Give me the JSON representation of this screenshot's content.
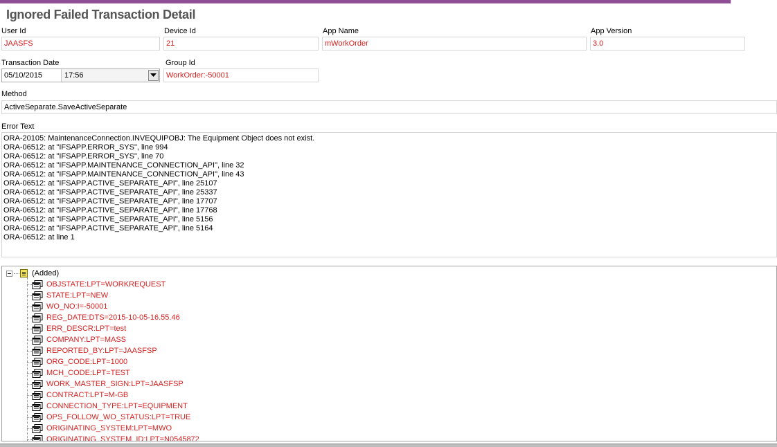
{
  "page": {
    "title": "Ignored Failed Transaction Detail"
  },
  "colors": {
    "accent": "#8e4f94",
    "value_text": "#d42020"
  },
  "fields": {
    "user_id": {
      "label": "User Id",
      "value": "JAASFS"
    },
    "device_id": {
      "label": "Device Id",
      "value": "21"
    },
    "app_name": {
      "label": "App Name",
      "value": "mWorkOrder"
    },
    "app_version": {
      "label": "App Version",
      "value": "3.0"
    },
    "transaction_date": {
      "label": "Transaction Date",
      "date": "05/10/2015",
      "time": "17:56"
    },
    "group_id": {
      "label": "Group Id",
      "value": "WorkOrder:-50001"
    },
    "method": {
      "label": "Method",
      "value": "ActiveSeparate.SaveActiveSeparate"
    },
    "error_text": {
      "label": "Error Text",
      "lines": [
        "ORA-20105: MaintenanceConnection.INVEQUIPOBJ: The Equipment Object does not exist.",
        "ORA-06512: at \"IFSAPP.ERROR_SYS\", line 994",
        "ORA-06512: at \"IFSAPP.ERROR_SYS\", line 70",
        "ORA-06512: at \"IFSAPP.MAINTENANCE_CONNECTION_API\", line 32",
        "ORA-06512: at \"IFSAPP.MAINTENANCE_CONNECTION_API\", line 43",
        "ORA-06512: at \"IFSAPP.ACTIVE_SEPARATE_API\", line 25107",
        "ORA-06512: at \"IFSAPP.ACTIVE_SEPARATE_API\", line 25337",
        "ORA-06512: at \"IFSAPP.ACTIVE_SEPARATE_API\", line 17707",
        "ORA-06512: at \"IFSAPP.ACTIVE_SEPARATE_API\", line 17768",
        "ORA-06512: at \"IFSAPP.ACTIVE_SEPARATE_API\", line 5156",
        "ORA-06512: at \"IFSAPP.ACTIVE_SEPARATE_API\", line 5164",
        "ORA-06512: at line 1"
      ]
    }
  },
  "tree": {
    "root_label": "(Added)",
    "items": [
      "OBJSTATE:LPT=WORKREQUEST",
      "STATE:LPT=NEW",
      "WO_NO:I=-50001",
      "REG_DATE:DTS=2015-10-05-16.55.46",
      "ERR_DESCR:LPT=test",
      "COMPANY:LPT=MASS",
      "REPORTED_BY:LPT=JAASFSP",
      "ORG_CODE:LPT=1000",
      "MCH_CODE:LPT=TEST",
      "WORK_MASTER_SIGN:LPT=JAASFSP",
      "CONTRACT:LPT=M-GB",
      "CONNECTION_TYPE:LPT=EQUIPMENT",
      "OPS_FOLLOW_WO_STATUS:LPT=TRUE",
      "ORIGINATING_SYSTEM:LPT=MWO",
      "ORIGINATING_SYSTEM_ID:LPT=N0545872"
    ]
  }
}
